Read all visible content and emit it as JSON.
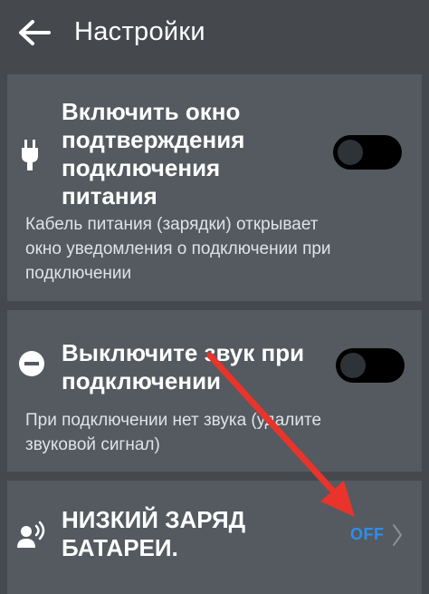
{
  "header": {
    "title": "Настройки",
    "back_icon": "arrow-left-icon"
  },
  "settings": [
    {
      "title": "Включить окно\nподтверждения\nподключения\nпитания",
      "description": "Кабель питания (зарядки) открывает\nокно уведомления о подключении при\nподключении",
      "icon": "power-plug-icon",
      "control": "toggle",
      "enabled": false
    },
    {
      "title": "Выключите звук при\nподключении",
      "description": "При подключении нет звука (удалите\nзвуковой сигнал)",
      "icon": "minus-circle-icon",
      "control": "toggle",
      "enabled": false
    },
    {
      "title": "НИЗКИЙ ЗАРЯД\nБАТАРЕИ.",
      "icon": "speaker-person-icon",
      "control": "value-chevron",
      "value": "OFF"
    }
  ],
  "colors": {
    "background": "#45494e",
    "card": "#545a60",
    "toggle_off": "#000000",
    "value_accent": "#2b8ff0",
    "annotation_arrow": "#e8342b"
  }
}
